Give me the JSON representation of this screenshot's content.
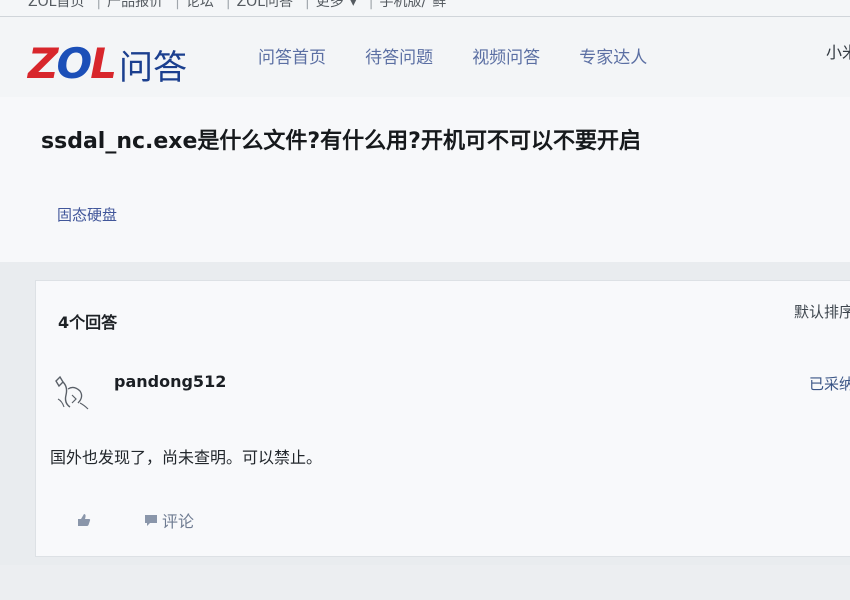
{
  "topbar": {
    "items": [
      "ZOL首页",
      "产品报价",
      "论坛",
      "ZOL问答",
      "更多",
      "手机版/",
      "鲜"
    ]
  },
  "header": {
    "logo_brand": "ZOL",
    "logo_text": "问答",
    "nav": [
      "问答首页",
      "待答问题",
      "视频问答",
      "专家达人"
    ],
    "user_link": "小米"
  },
  "question": {
    "title": "ssdal_nc.exe是什么文件?有什么用?开机可不可以不要开启",
    "tag": "固态硬盘"
  },
  "answers": {
    "count_label": "4个回答",
    "sort_label": "默认排序",
    "items": [
      {
        "username": "pandong512",
        "status": "已采纳",
        "body": "国外也发现了，尚未查明。可以禁止。",
        "comment_label": "评论",
        "avatar_icon": "sketch-avatar-icon",
        "like_icon": "thumbs-up-icon",
        "comment_icon": "comment-bubble-icon"
      }
    ]
  },
  "colors": {
    "brand_red": "#d8262c",
    "brand_blue": "#1b4fb8",
    "nav_text": "#5b6fa3",
    "tag_text": "#41569a"
  }
}
